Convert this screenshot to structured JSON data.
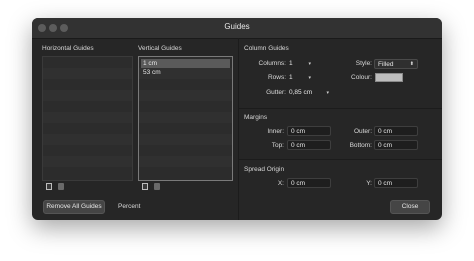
{
  "window": {
    "title": "Guides"
  },
  "horizontal": {
    "header": "Horizontal Guides"
  },
  "vertical": {
    "header": "Vertical Guides",
    "items": [
      "1 cm",
      "53 cm"
    ]
  },
  "buttons": {
    "remove_all": "Remove All Guides",
    "close": "Close"
  },
  "percent_label": "Percent",
  "column_guides": {
    "header": "Column Guides",
    "columns_label": "Columns:",
    "columns_value": "1",
    "rows_label": "Rows:",
    "rows_value": "1",
    "gutter_label": "Gutter:",
    "gutter_value": "0,85 cm",
    "style_label": "Style:",
    "style_value": "Filled",
    "colour_label": "Colour:",
    "colour_value": "#bdbdbd"
  },
  "margins": {
    "header": "Margins",
    "inner_label": "Inner:",
    "inner_value": "0 cm",
    "outer_label": "Outer:",
    "outer_value": "0 cm",
    "top_label": "Top:",
    "top_value": "0 cm",
    "bottom_label": "Bottom:",
    "bottom_value": "0 cm"
  },
  "spread_origin": {
    "header": "Spread Origin",
    "x_label": "X:",
    "x_value": "0 cm",
    "y_label": "Y:",
    "y_value": "0 cm"
  },
  "icons": {
    "add_horizontal": "add-document-icon",
    "delete_horizontal": "trash-icon",
    "add_vertical": "add-document-icon",
    "delete_vertical": "trash-icon"
  }
}
